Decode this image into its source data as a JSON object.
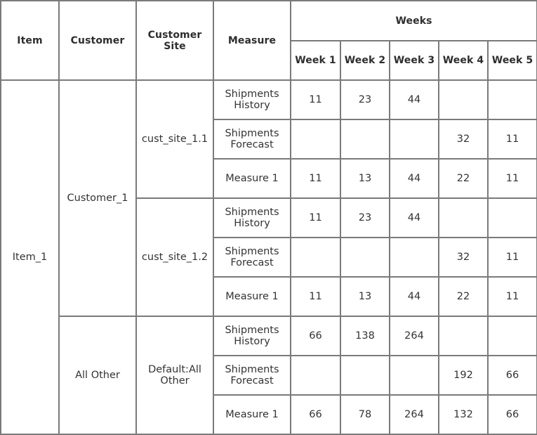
{
  "headers": {
    "item": "Item",
    "customer": "Customer",
    "customer_site": [
      "Customer",
      "Site"
    ],
    "measure": "Measure",
    "weeks_group": "Weeks",
    "weeks": [
      "Week 1",
      "Week 2",
      "Week 3",
      "Week 4",
      "Week 5"
    ]
  },
  "item": "Item_1",
  "customers": [
    {
      "name": "Customer_1",
      "sites": [
        {
          "name": [
            "cust_site_1.1"
          ],
          "measures": [
            {
              "label": [
                "Shipments",
                "History"
              ],
              "values": [
                "11",
                "23",
                "44",
                "",
                ""
              ]
            },
            {
              "label": [
                "Shipments",
                "Forecast"
              ],
              "values": [
                "",
                "",
                "",
                "32",
                "11"
              ]
            },
            {
              "label": [
                "Measure 1"
              ],
              "values": [
                "11",
                "13",
                "44",
                "22",
                "11"
              ]
            }
          ]
        },
        {
          "name": [
            "cust_site_1.2"
          ],
          "measures": [
            {
              "label": [
                "Shipments",
                "History"
              ],
              "values": [
                "11",
                "23",
                "44",
                "",
                ""
              ]
            },
            {
              "label": [
                "Shipments",
                "Forecast"
              ],
              "values": [
                "",
                "",
                "",
                "32",
                "11"
              ]
            },
            {
              "label": [
                "Measure 1"
              ],
              "values": [
                "11",
                "13",
                "44",
                "22",
                "11"
              ]
            }
          ]
        }
      ]
    },
    {
      "name": "All Other",
      "sites": [
        {
          "name": [
            "Default:All",
            "Other"
          ],
          "measures": [
            {
              "label": [
                "Shipments",
                "History"
              ],
              "values": [
                "66",
                "138",
                "264",
                "",
                ""
              ]
            },
            {
              "label": [
                "Shipments",
                "Forecast"
              ],
              "values": [
                "",
                "",
                "",
                "192",
                "66"
              ]
            },
            {
              "label": [
                "Measure 1"
              ],
              "values": [
                "66",
                "78",
                "264",
                "132",
                "66"
              ]
            }
          ]
        }
      ]
    }
  ]
}
